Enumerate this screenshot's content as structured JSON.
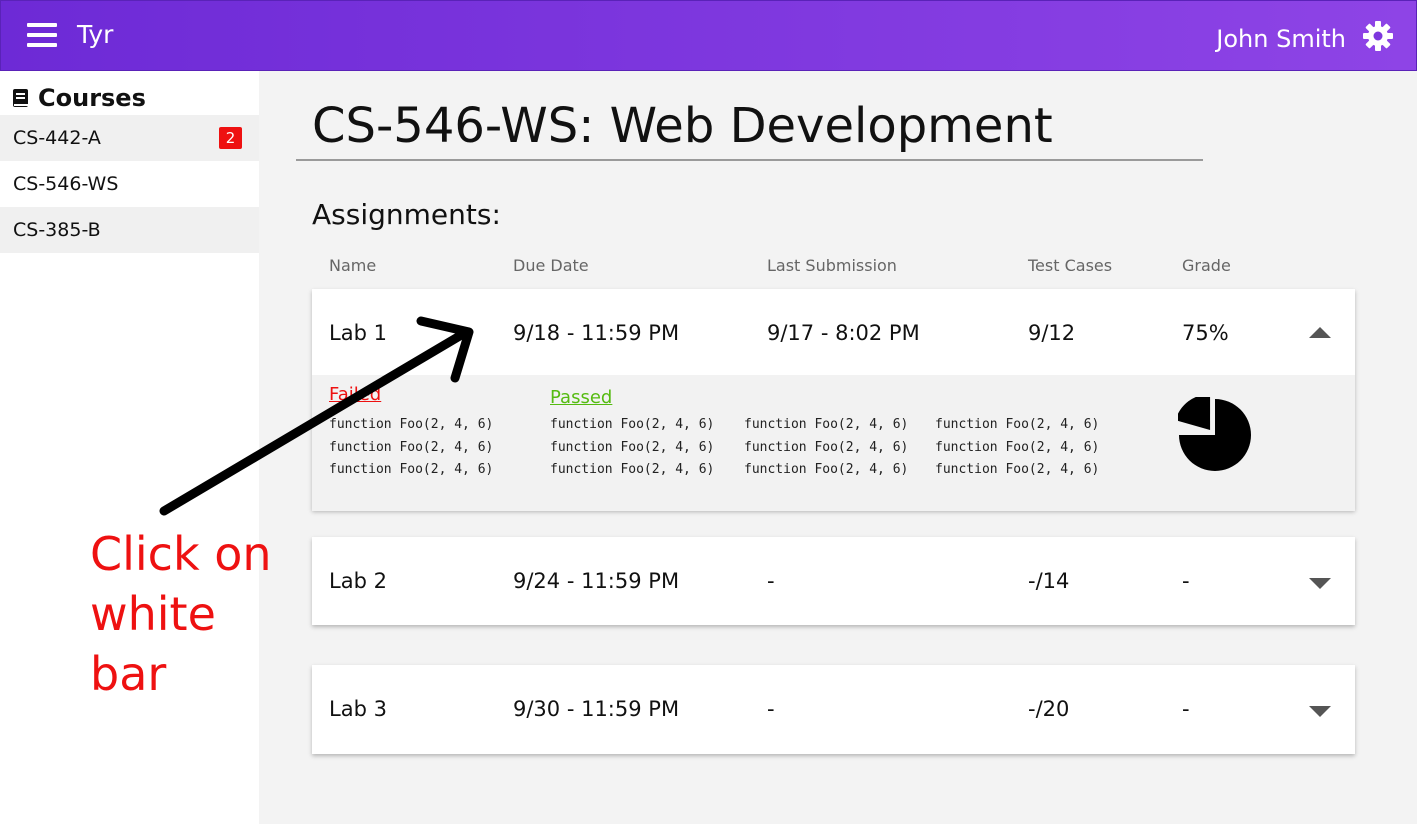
{
  "header": {
    "app_title": "Tyr",
    "user_name": "John Smith",
    "menu_icon": "hamburger-icon",
    "settings_icon": "gear-icon",
    "gradient": [
      "#6d2ad6",
      "#8e44e6"
    ]
  },
  "sidebar": {
    "title": "Courses",
    "title_icon": "book-icon",
    "items": [
      {
        "label": "CS-442-A",
        "badge": "2"
      },
      {
        "label": "CS-546-WS",
        "badge": ""
      },
      {
        "label": "CS-385-B",
        "badge": ""
      }
    ]
  },
  "main": {
    "course_title": "CS-546-WS: Web Development",
    "section_title": "Assignments:",
    "columns": [
      "Name",
      "Due Date",
      "Last Submission",
      "Test Cases",
      "Grade"
    ],
    "assignments": [
      {
        "name": "Lab 1",
        "due": "9/18 - 11:59 PM",
        "last_submission": "9/17 - 8:02 PM",
        "tests": "9/12",
        "grade": "75%",
        "expanded": true
      },
      {
        "name": "Lab 2",
        "due": "9/24 - 11:59 PM",
        "last_submission": "-",
        "tests": "-/14",
        "grade": "-",
        "expanded": false
      },
      {
        "name": "Lab 3",
        "due": "9/30 - 11:59 PM",
        "last_submission": "-",
        "tests": "-/20",
        "grade": "-",
        "expanded": false
      }
    ],
    "details": {
      "failed_label": "Failed",
      "passed_label": "Passed",
      "failed_tests": [
        "function Foo(2, 4, 6)",
        "function Foo(2, 4, 6)",
        "function Foo(2, 4, 6)"
      ],
      "passed_tests": [
        [
          "function Foo(2, 4, 6)",
          "function Foo(2, 4, 6)",
          "function Foo(2, 4, 6)"
        ],
        [
          "function Foo(2, 4, 6)",
          "function Foo(2, 4, 6)",
          "function Foo(2, 4, 6)"
        ],
        [
          "function Foo(2, 4, 6)",
          "function Foo(2, 4, 6)",
          "function Foo(2, 4, 6)"
        ]
      ],
      "grade_fraction": 0.75,
      "chart_icon": "pie-chart-icon",
      "failed_color": "#ee1111",
      "passed_color": "#55bb11"
    }
  },
  "annotation": {
    "lines": [
      "Click on",
      "white",
      "bar"
    ],
    "color": "#ee1111"
  }
}
